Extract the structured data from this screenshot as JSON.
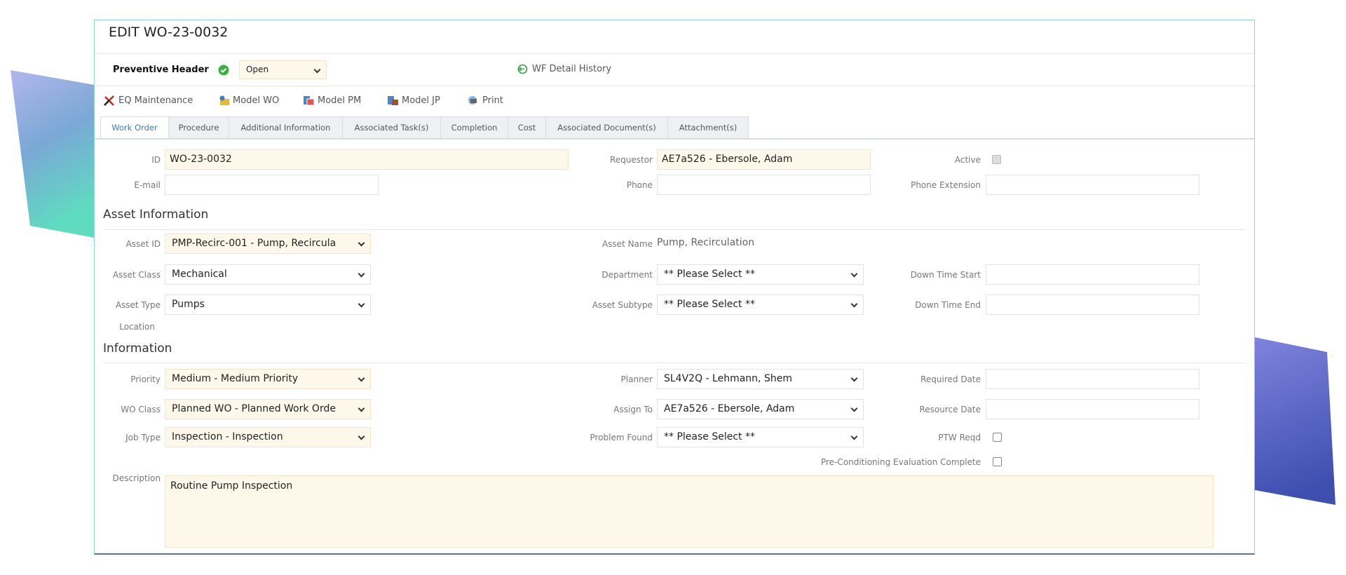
{
  "title": "EDIT WO-23-0032",
  "header": {
    "label": "Preventive Header",
    "status": "Open",
    "wf_history": "WF Detail History"
  },
  "toolbar": {
    "eq": "EQ Maintenance",
    "model_wo": "Model WO",
    "model_pm": "Model PM",
    "model_jp": "Model JP",
    "print": "Print"
  },
  "tabs": [
    "Work Order",
    "Procedure",
    "Additional Information",
    "Associated Task(s)",
    "Completion",
    "Cost",
    "Associated Document(s)",
    "Attachment(s)"
  ],
  "work_order": {
    "id_label": "ID",
    "id": "WO-23-0032",
    "requestor_label": "Requestor",
    "requestor": "AE7a526 - Ebersole, Adam",
    "active_label": "Active",
    "email_label": "E-mail",
    "email": "",
    "phone_label": "Phone",
    "phone": "",
    "phone_ext_label": "Phone Extension",
    "phone_ext": ""
  },
  "asset": {
    "heading": "Asset Information",
    "asset_id_label": "Asset ID",
    "asset_id": "PMP-Recirc-001 - Pump, Recircula",
    "asset_name_label": "Asset Name",
    "asset_name": "Pump, Recirculation",
    "asset_class_label": "Asset Class",
    "asset_class": "Mechanical",
    "department_label": "Department",
    "department": "** Please Select **",
    "down_start_label": "Down Time Start",
    "down_start": "",
    "asset_type_label": "Asset Type",
    "asset_type": "Pumps",
    "asset_subtype_label": "Asset Subtype",
    "asset_subtype": "** Please Select **",
    "down_end_label": "Down Time End",
    "down_end": "",
    "location_label": "Location"
  },
  "info": {
    "heading": "Information",
    "priority_label": "Priority",
    "priority": "Medium - Medium Priority",
    "planner_label": "Planner",
    "planner": "SL4V2Q - Lehmann, Shem",
    "required_date_label": "Required Date",
    "required_date": "",
    "wo_class_label": "WO Class",
    "wo_class": "Planned WO - Planned Work Orde",
    "assign_to_label": "Assign To",
    "assign_to": "AE7a526 - Ebersole, Adam",
    "resource_date_label": "Resource Date",
    "resource_date": "",
    "job_type_label": "Job Type",
    "job_type": "Inspection - Inspection",
    "problem_found_label": "Problem Found",
    "problem_found": "** Please Select **",
    "ptw_label": "PTW Reqd",
    "precond_label": "Pre-Conditioning Evaluation Complete",
    "description_label": "Description",
    "description": "Routine Pump Inspection"
  },
  "colors": {
    "accent": "#3a7cc2",
    "field_required": "#fdf8e9",
    "deco_left_top": "#aab0e8",
    "deco_left_bottom": "#5fdcc0",
    "deco_right": "#5b63c8"
  }
}
